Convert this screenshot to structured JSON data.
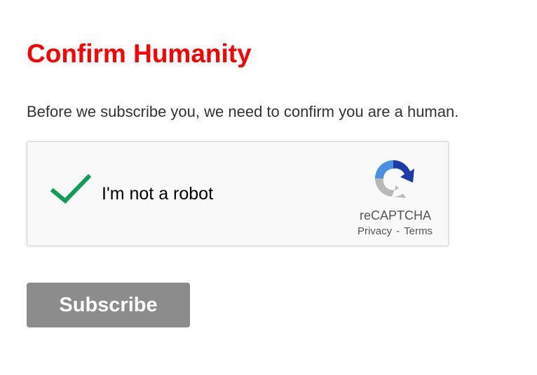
{
  "page": {
    "title": "Confirm Humanity",
    "intro_text": "Before we subscribe you, we need to confirm you are a human."
  },
  "captcha": {
    "label": "I'm not a robot",
    "checked": true,
    "brand": "reCAPTCHA",
    "privacy_link": "Privacy",
    "separator": "-",
    "terms_link": "Terms",
    "checkmark_icon": "checkmark-icon",
    "logo_icon": "recaptcha-logo-icon"
  },
  "form": {
    "subscribe_label": "Subscribe"
  },
  "colors": {
    "title": "#ff0000",
    "checkmark": "#0f9d58",
    "button_bg": "#8c8c8c",
    "logo_blue_light": "#4a90e2",
    "logo_blue_dark": "#1c3aa9",
    "logo_gray": "#b8b8b8"
  }
}
